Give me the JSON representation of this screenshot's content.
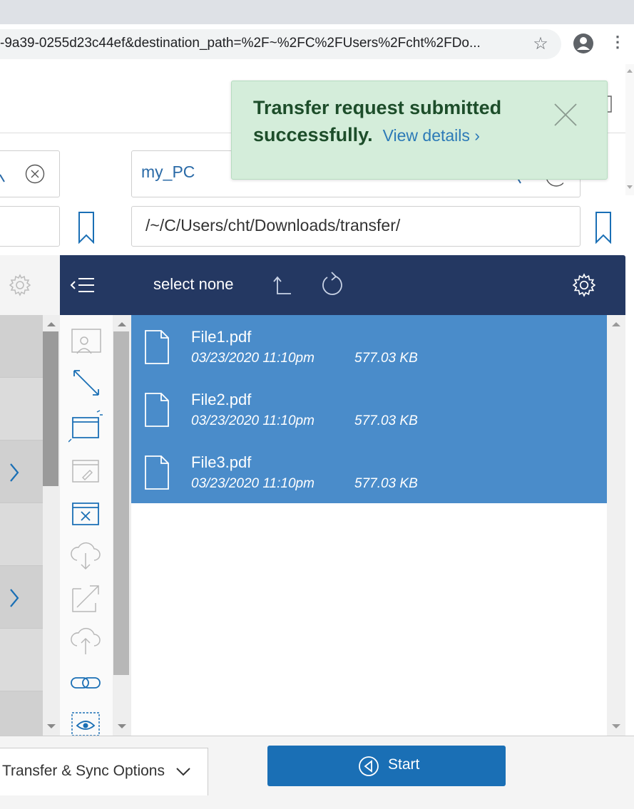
{
  "browser": {
    "url": "-9a39-0255d23c44ef&destination_path=%2F~%2FC%2FUsers%2Fcht%2FDo..."
  },
  "endpoints": {
    "destination_endpoint": "my_PC",
    "destination_path": "/~/C/Users/cht/Downloads/transfer/"
  },
  "toolbar": {
    "select_none_label": "select none"
  },
  "files": [
    {
      "name": "File1.pdf",
      "date": "03/23/2020 11:10pm",
      "size": "577.03 KB"
    },
    {
      "name": "File2.pdf",
      "date": "03/23/2020 11:10pm",
      "size": "577.03 KB"
    },
    {
      "name": "File3.pdf",
      "date": "03/23/2020 11:10pm",
      "size": "577.03 KB"
    }
  ],
  "footer": {
    "options_label": "Transfer & Sync Options",
    "start_label": "Start"
  },
  "toast": {
    "message": "Transfer request submitted successfully.",
    "link": "View details"
  },
  "colors": {
    "header_navy": "#243862",
    "selected_row": "#4a8cca",
    "start_button": "#1a6fb5",
    "toast_bg": "#d4edda",
    "toast_text": "#1d4d2a",
    "link_blue": "#2c7ab7"
  }
}
